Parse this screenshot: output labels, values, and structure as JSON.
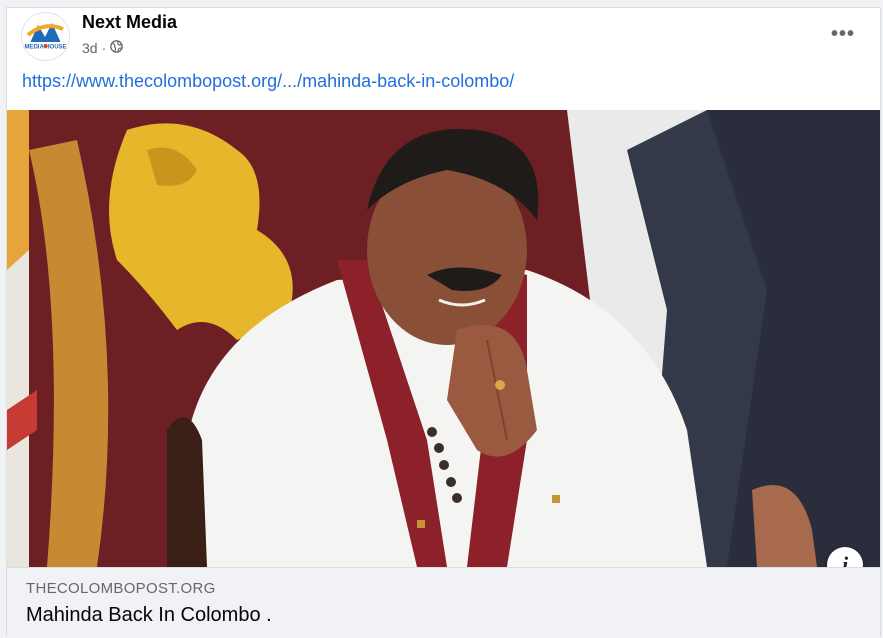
{
  "post": {
    "page_name": "Next Media",
    "timestamp": "3d",
    "separator": "·",
    "audience_icon": "globe-icon",
    "more_icon": "more-options-icon",
    "more_glyph": "•••",
    "link_url": "https://www.thecolombopost.org/.../mahinda-back-in-colombo/"
  },
  "avatar": {
    "logo_text": "MEDIA HOUSE",
    "colors": {
      "orange": "#f5a623",
      "blue": "#1e6bb8",
      "red": "#d6402b"
    }
  },
  "link_preview": {
    "domain": "THECOLOMBOPOST.ORG",
    "title": "Mahinda Back In Colombo .",
    "info_icon": "info-icon",
    "info_glyph": "i"
  },
  "colors": {
    "link": "#216fdb",
    "meta": "#65676b",
    "footer_bg": "#f0f2f5"
  }
}
